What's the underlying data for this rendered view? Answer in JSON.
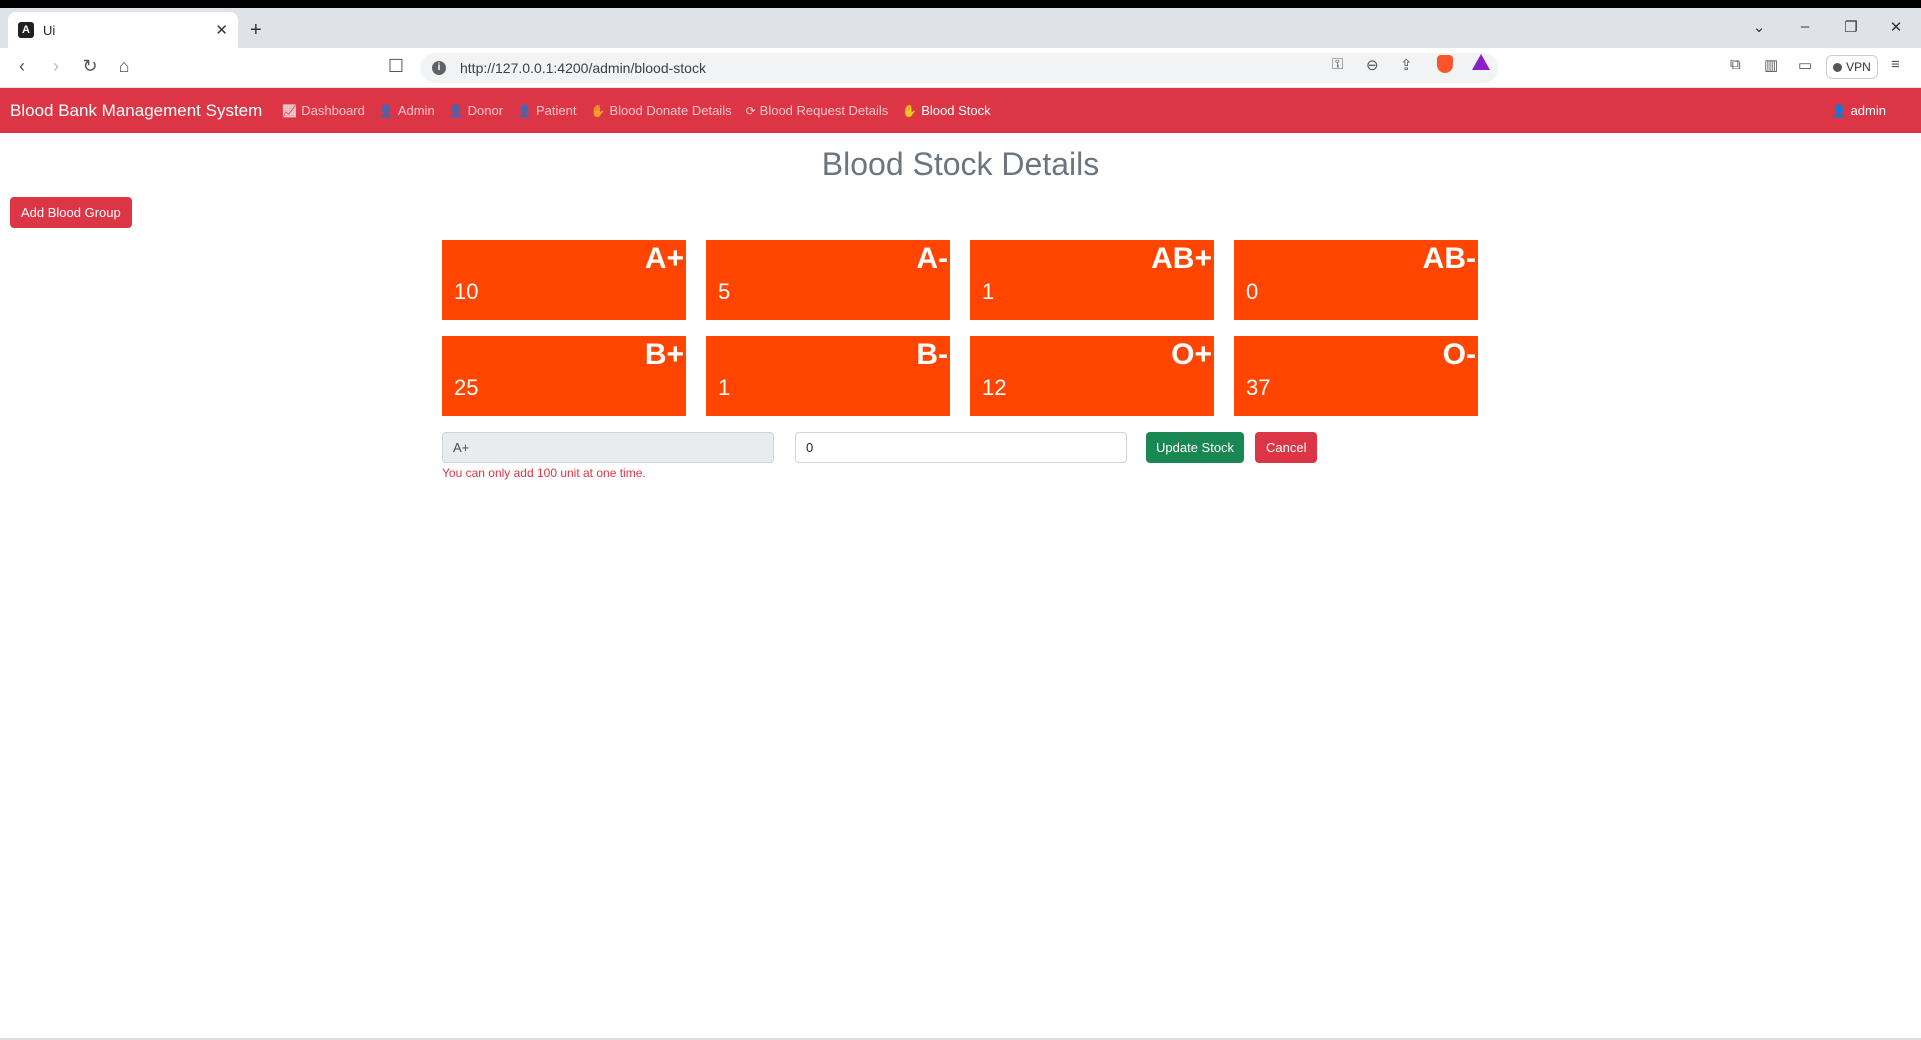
{
  "browser": {
    "tab_title": "Ui",
    "url": "http://127.0.0.1:4200/admin/blood-stock",
    "vpn_label": "VPN"
  },
  "navbar": {
    "brand": "Blood Bank Management System",
    "links": [
      {
        "label": "Dashboard",
        "icon": "chart-line-icon"
      },
      {
        "label": "Admin",
        "icon": "user-icon"
      },
      {
        "label": "Donor",
        "icon": "user-icon"
      },
      {
        "label": "Patient",
        "icon": "user-icon"
      },
      {
        "label": "Blood Donate Details",
        "icon": "hand-holding-icon"
      },
      {
        "label": "Blood Request Details",
        "icon": "refresh-icon"
      },
      {
        "label": "Blood Stock",
        "icon": "hand-holding-icon",
        "active": true
      }
    ],
    "user": "admin"
  },
  "page": {
    "title": "Blood Stock Details",
    "add_button": "Add Blood Group"
  },
  "stock": [
    {
      "group": "A+",
      "units": "10"
    },
    {
      "group": "A-",
      "units": "5"
    },
    {
      "group": "AB+",
      "units": "1"
    },
    {
      "group": "AB-",
      "units": "0"
    },
    {
      "group": "B+",
      "units": "25"
    },
    {
      "group": "B-",
      "units": "1"
    },
    {
      "group": "O+",
      "units": "12"
    },
    {
      "group": "O-",
      "units": "37"
    }
  ],
  "form": {
    "blood_group_value": "A+",
    "unit_value": "0",
    "update_button": "Update Stock",
    "cancel_button": "Cancel",
    "error": "You can only add 100 unit at one time."
  },
  "colors": {
    "navbar": "#dc3545",
    "card": "#ff4500",
    "update": "#198754"
  }
}
